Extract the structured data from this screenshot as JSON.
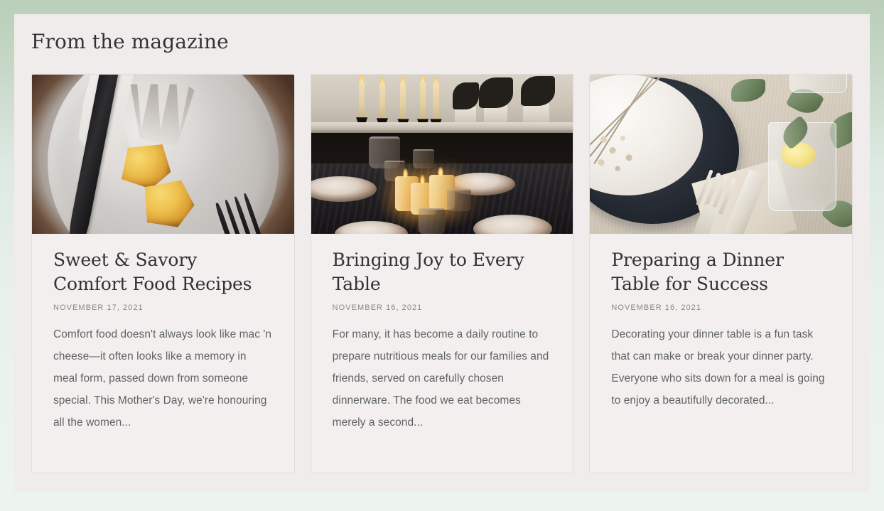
{
  "section": {
    "title": "From the magazine"
  },
  "theme": {
    "page_background_top": "#b9ceb9",
    "page_background_bottom": "#edf4ef",
    "panel_background": "#f0eceb",
    "card_background": "#f3efee",
    "card_border": "#e2dcda",
    "title_color": "#2f3337",
    "date_color": "#8d8784",
    "body_color": "#5e6366"
  },
  "articles": [
    {
      "image_name": "plate-with-leftover-casserole-knife-fork",
      "title": "Sweet & Savory Comfort Food Recipes",
      "date": "NOVEMBER 17, 2021",
      "excerpt": "Comfort food doesn't always look like mac 'n cheese—it often looks like a memory in meal form, passed down from someone special. This Mother's Day, we're honouring all the women..."
    },
    {
      "image_name": "candlelit-dinner-table-with-taper-candles",
      "title": "Bringing Joy to Every Table",
      "date": "NOVEMBER 16, 2021",
      "excerpt": "For many, it has become a daily routine to prepare nutritious meals for our families and friends, served on carefully chosen dinnerware. The food we eat becomes merely a second..."
    },
    {
      "image_name": "place-setting-white-plate-navy-plate-water-glass",
      "title": "Preparing a Dinner Table for Success",
      "date": "NOVEMBER 16, 2021",
      "excerpt": "Decorating your dinner table is a fun task that can make or break your dinner party. Everyone who sits down for a meal is going to enjoy a beautifully decorated..."
    }
  ]
}
